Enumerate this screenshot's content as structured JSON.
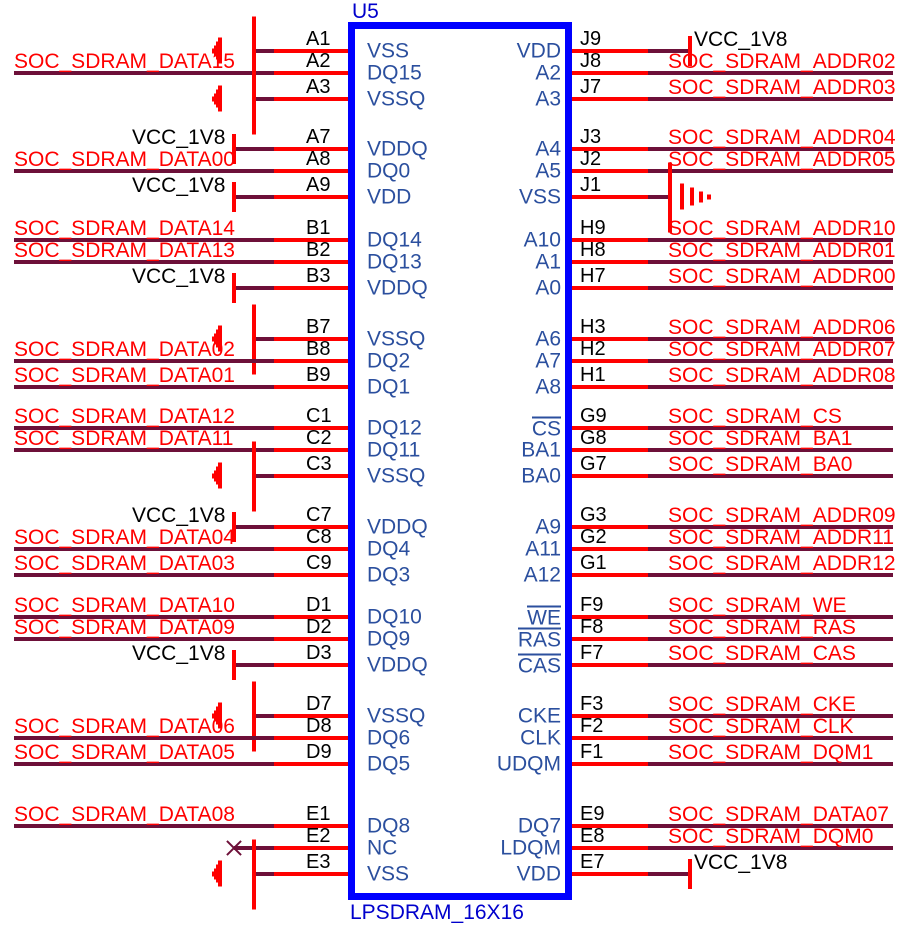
{
  "component": {
    "reference": "U5",
    "device_name": "LPSDRAM_16X16",
    "outline_color": "#0000ff",
    "pin_label_color": "#2b4f9e",
    "pin_number_color": "#000000",
    "net_label_color": "#ff0000",
    "wire_color": "#ff0000",
    "net_wire_color": "#6d1039"
  },
  "left_groups": [
    {
      "rows": [
        {
          "pin": "A1",
          "name": "VSS",
          "overbar": false,
          "net": "",
          "net_type": "gnd"
        },
        {
          "pin": "A2",
          "name": "DQ15",
          "overbar": false,
          "net": "SOC_SDRAM_DATA15",
          "net_type": "net"
        },
        {
          "pin": "A3",
          "name": "VSSQ",
          "overbar": false,
          "net": "",
          "net_type": "gnd"
        }
      ]
    },
    {
      "rows": [
        {
          "pin": "A7",
          "name": "VDDQ",
          "overbar": false,
          "net": "VCC_1V8",
          "net_type": "pwr"
        },
        {
          "pin": "A8",
          "name": "DQ0",
          "overbar": false,
          "net": "SOC_SDRAM_DATA00",
          "net_type": "net"
        },
        {
          "pin": "A9",
          "name": "VDD",
          "overbar": false,
          "net": "VCC_1V8",
          "net_type": "pwr"
        }
      ]
    },
    {
      "rows": [
        {
          "pin": "B1",
          "name": "DQ14",
          "overbar": false,
          "net": "SOC_SDRAM_DATA14",
          "net_type": "net"
        },
        {
          "pin": "B2",
          "name": "DQ13",
          "overbar": false,
          "net": "SOC_SDRAM_DATA13",
          "net_type": "net"
        },
        {
          "pin": "B3",
          "name": "VDDQ",
          "overbar": false,
          "net": "VCC_1V8",
          "net_type": "pwr"
        }
      ]
    },
    {
      "rows": [
        {
          "pin": "B7",
          "name": "VSSQ",
          "overbar": false,
          "net": "",
          "net_type": "gnd"
        },
        {
          "pin": "B8",
          "name": "DQ2",
          "overbar": false,
          "net": "SOC_SDRAM_DATA02",
          "net_type": "net"
        },
        {
          "pin": "B9",
          "name": "DQ1",
          "overbar": false,
          "net": "SOC_SDRAM_DATA01",
          "net_type": "net"
        }
      ]
    },
    {
      "rows": [
        {
          "pin": "C1",
          "name": "DQ12",
          "overbar": false,
          "net": "SOC_SDRAM_DATA12",
          "net_type": "net"
        },
        {
          "pin": "C2",
          "name": "DQ11",
          "overbar": false,
          "net": "SOC_SDRAM_DATA11",
          "net_type": "net"
        },
        {
          "pin": "C3",
          "name": "VSSQ",
          "overbar": false,
          "net": "",
          "net_type": "gnd"
        }
      ]
    },
    {
      "rows": [
        {
          "pin": "C7",
          "name": "VDDQ",
          "overbar": false,
          "net": "VCC_1V8",
          "net_type": "pwr"
        },
        {
          "pin": "C8",
          "name": "DQ4",
          "overbar": false,
          "net": "SOC_SDRAM_DATA04",
          "net_type": "net"
        },
        {
          "pin": "C9",
          "name": "DQ3",
          "overbar": false,
          "net": "SOC_SDRAM_DATA03",
          "net_type": "net"
        }
      ]
    },
    {
      "rows": [
        {
          "pin": "D1",
          "name": "DQ10",
          "overbar": false,
          "net": "SOC_SDRAM_DATA10",
          "net_type": "net"
        },
        {
          "pin": "D2",
          "name": "DQ9",
          "overbar": false,
          "net": "SOC_SDRAM_DATA09",
          "net_type": "net"
        },
        {
          "pin": "D3",
          "name": "VDDQ",
          "overbar": false,
          "net": "VCC_1V8",
          "net_type": "pwr"
        }
      ]
    },
    {
      "rows": [
        {
          "pin": "D7",
          "name": "VSSQ",
          "overbar": false,
          "net": "",
          "net_type": "gnd"
        },
        {
          "pin": "D8",
          "name": "DQ6",
          "overbar": false,
          "net": "SOC_SDRAM_DATA06",
          "net_type": "net"
        },
        {
          "pin": "D9",
          "name": "DQ5",
          "overbar": false,
          "net": "SOC_SDRAM_DATA05",
          "net_type": "net"
        }
      ]
    },
    {
      "rows": [
        {
          "pin": "E1",
          "name": "DQ8",
          "overbar": false,
          "net": "SOC_SDRAM_DATA08",
          "net_type": "net"
        },
        {
          "pin": "E2",
          "name": "NC",
          "overbar": false,
          "net": "",
          "net_type": "nc"
        },
        {
          "pin": "E3",
          "name": "VSS",
          "overbar": false,
          "net": "",
          "net_type": "gnd"
        }
      ]
    }
  ],
  "right_groups": [
    {
      "rows": [
        {
          "pin": "J9",
          "name": "VDD",
          "overbar": false,
          "net": "VCC_1V8",
          "net_type": "pwr"
        },
        {
          "pin": "J8",
          "name": "A2",
          "overbar": false,
          "net": "SOC_SDRAM_ADDR02",
          "net_type": "net"
        },
        {
          "pin": "J7",
          "name": "A3",
          "overbar": false,
          "net": "SOC_SDRAM_ADDR03",
          "net_type": "net"
        }
      ]
    },
    {
      "rows": [
        {
          "pin": "J3",
          "name": "A4",
          "overbar": false,
          "net": "SOC_SDRAM_ADDR04",
          "net_type": "net"
        },
        {
          "pin": "J2",
          "name": "A5",
          "overbar": false,
          "net": "SOC_SDRAM_ADDR05",
          "net_type": "net"
        },
        {
          "pin": "J1",
          "name": "VSS",
          "overbar": false,
          "net": "",
          "net_type": "gnd"
        }
      ]
    },
    {
      "rows": [
        {
          "pin": "H9",
          "name": "A10",
          "overbar": false,
          "net": "SOC_SDRAM_ADDR10",
          "net_type": "net"
        },
        {
          "pin": "H8",
          "name": "A1",
          "overbar": false,
          "net": "SOC_SDRAM_ADDR01",
          "net_type": "net"
        },
        {
          "pin": "H7",
          "name": "A0",
          "overbar": false,
          "net": "SOC_SDRAM_ADDR00",
          "net_type": "net"
        }
      ]
    },
    {
      "rows": [
        {
          "pin": "H3",
          "name": "A6",
          "overbar": false,
          "net": "SOC_SDRAM_ADDR06",
          "net_type": "net"
        },
        {
          "pin": "H2",
          "name": "A7",
          "overbar": false,
          "net": "SOC_SDRAM_ADDR07",
          "net_type": "net"
        },
        {
          "pin": "H1",
          "name": "A8",
          "overbar": false,
          "net": "SOC_SDRAM_ADDR08",
          "net_type": "net"
        }
      ]
    },
    {
      "rows": [
        {
          "pin": "G9",
          "name": "CS",
          "overbar": true,
          "net": "SOC_SDRAM_CS",
          "net_type": "net"
        },
        {
          "pin": "G8",
          "name": "BA1",
          "overbar": false,
          "net": "SOC_SDRAM_BA1",
          "net_type": "net"
        },
        {
          "pin": "G7",
          "name": "BA0",
          "overbar": false,
          "net": "SOC_SDRAM_BA0",
          "net_type": "net"
        }
      ]
    },
    {
      "rows": [
        {
          "pin": "G3",
          "name": "A9",
          "overbar": false,
          "net": "SOC_SDRAM_ADDR09",
          "net_type": "net"
        },
        {
          "pin": "G2",
          "name": "A11",
          "overbar": false,
          "net": "SOC_SDRAM_ADDR11",
          "net_type": "net"
        },
        {
          "pin": "G1",
          "name": "A12",
          "overbar": false,
          "net": "SOC_SDRAM_ADDR12",
          "net_type": "net"
        }
      ]
    },
    {
      "rows": [
        {
          "pin": "F9",
          "name": "WE",
          "overbar": true,
          "net": "SOC_SDRAM_WE",
          "net_type": "net"
        },
        {
          "pin": "F8",
          "name": "RAS",
          "overbar": true,
          "net": "SOC_SDRAM_RAS",
          "net_type": "net"
        },
        {
          "pin": "F7",
          "name": "CAS",
          "overbar": true,
          "net": "SOC_SDRAM_CAS",
          "net_type": "net"
        }
      ]
    },
    {
      "rows": [
        {
          "pin": "F3",
          "name": "CKE",
          "overbar": false,
          "net": "SOC_SDRAM_CKE",
          "net_type": "net"
        },
        {
          "pin": "F2",
          "name": "CLK",
          "overbar": false,
          "net": "SOC_SDRAM_CLK",
          "net_type": "net"
        },
        {
          "pin": "F1",
          "name": "UDQM",
          "overbar": false,
          "net": "SOC_SDRAM_DQM1",
          "net_type": "net"
        }
      ]
    },
    {
      "rows": [
        {
          "pin": "E9",
          "name": "DQ7",
          "overbar": false,
          "net": "SOC_SDRAM_DATA07",
          "net_type": "net"
        },
        {
          "pin": "E8",
          "name": "LDQM",
          "overbar": false,
          "net": "SOC_SDRAM_DQM0",
          "net_type": "net"
        },
        {
          "pin": "E7",
          "name": "VDD",
          "overbar": false,
          "net": "VCC_1V8",
          "net_type": "pwr"
        }
      ]
    }
  ]
}
